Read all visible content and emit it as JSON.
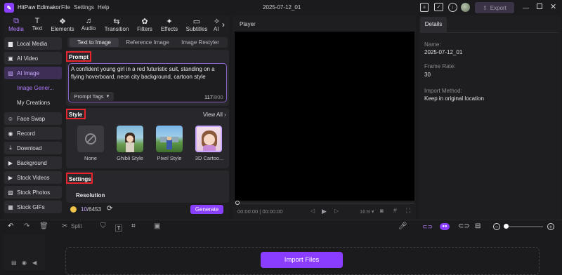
{
  "app": {
    "name": "HitPaw Edimakor",
    "menus": [
      "File",
      "Settings",
      "Help"
    ],
    "project_title": "2025-07-12_01",
    "export_label": "Export"
  },
  "tabs": [
    {
      "label": "Media",
      "icon": "media-icon"
    },
    {
      "label": "Text",
      "icon": "text-icon"
    },
    {
      "label": "Elements",
      "icon": "elements-icon"
    },
    {
      "label": "Audio",
      "icon": "audio-icon"
    },
    {
      "label": "Transition",
      "icon": "transition-icon"
    },
    {
      "label": "Filters",
      "icon": "filters-icon"
    },
    {
      "label": "Effects",
      "icon": "effects-icon"
    },
    {
      "label": "Subtitles",
      "icon": "subtitles-icon"
    },
    {
      "label": "AI",
      "icon": "ai-icon"
    }
  ],
  "sidebar": {
    "items": [
      {
        "label": "Local Media"
      },
      {
        "label": "AI Video"
      },
      {
        "label": "AI Image"
      },
      {
        "label": "Image Gener..."
      },
      {
        "label": "My Creations"
      },
      {
        "label": "Face Swap"
      },
      {
        "label": "Record"
      },
      {
        "label": "Download"
      },
      {
        "label": "Background"
      },
      {
        "label": "Stock Videos"
      },
      {
        "label": "Stock Photos"
      },
      {
        "label": "Stock GIFs"
      }
    ]
  },
  "image_tabs": [
    "Text to Image",
    "Reference Image",
    "Image Restyler"
  ],
  "prompt": {
    "heading": "Prompt",
    "text": "A confident young girl in a red futuristic suit, standing on a flying hoverboard, neon city background, cartoon style",
    "tags_label": "Prompt Tags",
    "count": "117",
    "max": "/800"
  },
  "style": {
    "heading": "Style",
    "view_all": "View All",
    "options": [
      "None",
      "Ghibli Style",
      "Pixel Style",
      "3D Cartoo..."
    ]
  },
  "settings": {
    "heading": "Settings",
    "resolution_label": "Resolution"
  },
  "credits": {
    "used": "10",
    "total": "/6453"
  },
  "generate_label": "Generate",
  "player": {
    "title": "Player",
    "time_current": "00:00:00",
    "time_total": "00:00:00",
    "aspect": "16:9"
  },
  "details": {
    "tab": "Details",
    "name_label": "Name:",
    "name_value": "2025-07-12_01",
    "frame_label": "Frame Rate:",
    "frame_value": "30",
    "import_label": "Import Method:",
    "import_value": "Keep in original location"
  },
  "timeline": {
    "split_label": "Split",
    "import_files_label": "Import Files"
  },
  "colors": {
    "accent": "#8a3ffc",
    "import_button": "#8b3dff",
    "highlight_box": "#e8242c"
  }
}
